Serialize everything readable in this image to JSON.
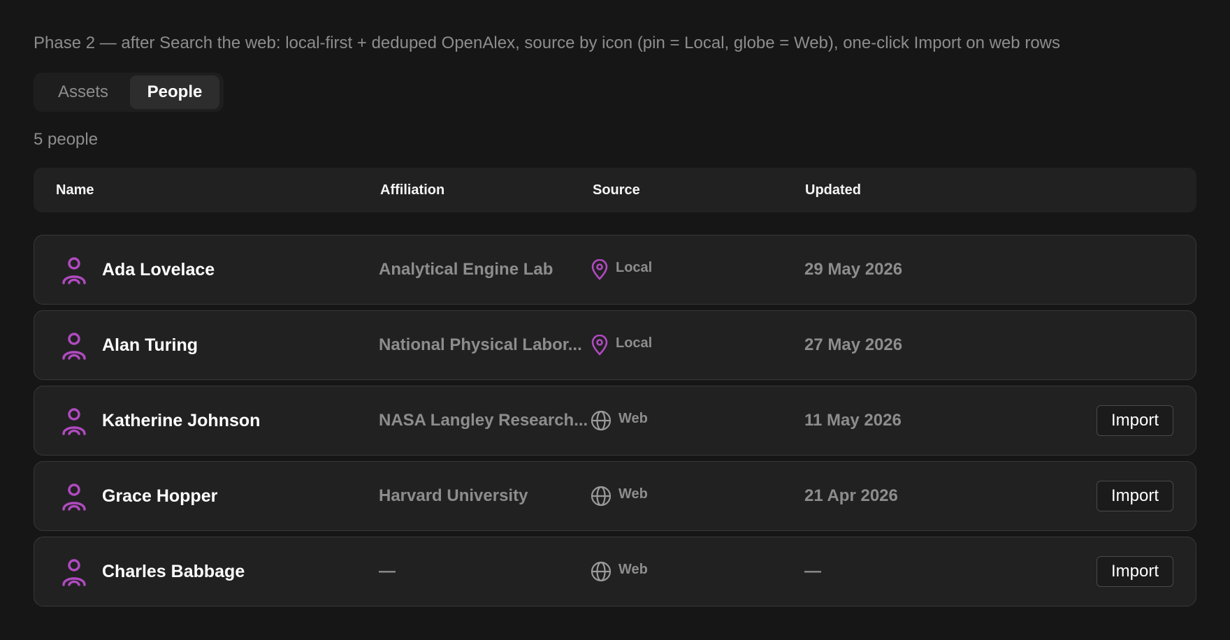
{
  "caption": "Phase 2 — after Search the web: local-first + deduped OpenAlex, source by icon (pin = Local, globe = Web), one-click Import on web rows",
  "tabs": [
    {
      "label": "Assets",
      "selected": false
    },
    {
      "label": "People",
      "selected": true
    }
  ],
  "count_label": "5 people",
  "columns": {
    "name": "Name",
    "affiliation": "Affiliation",
    "source": "Source",
    "updated": "Updated"
  },
  "colors": {
    "accent": "#b04ac0",
    "background": "#161616",
    "row": "#212121"
  },
  "rows": [
    {
      "name": "Ada Lovelace",
      "affiliation": "Analytical Engine Lab",
      "source": "Local",
      "source_icon": "map-pin-icon",
      "updated": "29 May 2026",
      "action": ""
    },
    {
      "name": "Alan Turing",
      "affiliation": "National Physical Labor...",
      "source": "Local",
      "source_icon": "map-pin-icon",
      "updated": "27 May 2026",
      "action": ""
    },
    {
      "name": "Katherine Johnson",
      "affiliation": "NASA Langley Research...",
      "source": "Web",
      "source_icon": "globe-icon",
      "updated": "11 May 2026",
      "action": "Import"
    },
    {
      "name": "Grace Hopper",
      "affiliation": "Harvard University",
      "source": "Web",
      "source_icon": "globe-icon",
      "updated": "21 Apr 2026",
      "action": "Import"
    },
    {
      "name": "Charles Babbage",
      "affiliation": "—",
      "source": "Web",
      "source_icon": "globe-icon",
      "updated": "—",
      "action": "Import"
    }
  ]
}
